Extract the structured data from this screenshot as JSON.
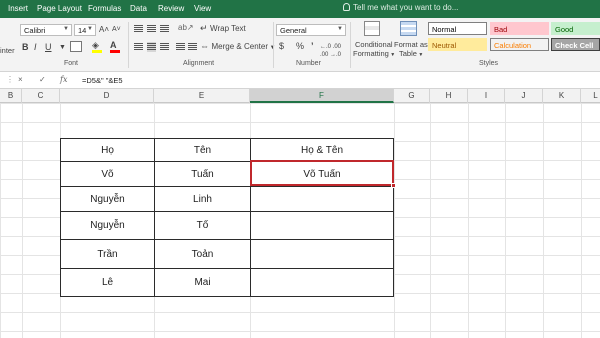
{
  "ribbon_tabs": [
    "Insert",
    "Page Layout",
    "Formulas",
    "Data",
    "Review",
    "View"
  ],
  "tell_me": "Tell me what you want to do...",
  "font": {
    "name": "Calibri",
    "size": "14",
    "increase_icon": "A˄",
    "decrease_icon": "A˅",
    "bold": "B",
    "italic": "I",
    "underline": "U",
    "fill_color": "#ffff00",
    "font_color": "#ff0000",
    "group_label": "Font"
  },
  "paste_partial": "inter",
  "alignment": {
    "wrap_text": "Wrap Text",
    "merge_center": "Merge & Center",
    "group_label": "Alignment"
  },
  "number": {
    "format": "General",
    "currency": "$",
    "percent": "%",
    "comma": "’",
    "inc_decimal": "←.0 .00",
    "dec_decimal": ".00 →.0",
    "group_label": "Number"
  },
  "styles": {
    "conditional_line1": "Conditional",
    "conditional_line2": "Formatting",
    "format_table_line1": "Format as",
    "format_table_line2": "Table",
    "items": [
      {
        "label": "Normal",
        "bg": "#ffffff",
        "color": "#000000",
        "border": "#7f7f7f"
      },
      {
        "label": "Bad",
        "bg": "#ffc7ce",
        "color": "#9c0006",
        "border": "#ffc7ce"
      },
      {
        "label": "Good",
        "bg": "#c6efce",
        "color": "#006100",
        "border": "#c6efce"
      },
      {
        "label": "Neutral",
        "bg": "#ffeb9c",
        "color": "#9c5700",
        "border": "#ffeb9c"
      },
      {
        "label": "Calculation",
        "bg": "#f2f2f2",
        "color": "#fa7d00",
        "border": "#7f7f7f"
      },
      {
        "label": "Check Cell",
        "bg": "#a5a5a5",
        "color": "#ffffff",
        "border": "#3f3f3f"
      }
    ],
    "group_label": "Styles"
  },
  "formula_bar": {
    "cancel": "×",
    "enter": "✓",
    "fx": "fx",
    "formula": "=D5&\" \"&E5"
  },
  "columns": [
    "B",
    "C",
    "D",
    "E",
    "F",
    "G",
    "H",
    "I",
    "J",
    "K",
    "L"
  ],
  "table": {
    "rows": [
      [
        "Họ",
        "Tên",
        "Họ & Tên"
      ],
      [
        "Võ",
        "Tuấn",
        "Võ Tuấn"
      ],
      [
        "Nguyễn",
        "Linh",
        ""
      ],
      [
        "Nguyễn",
        "Tố",
        ""
      ],
      [
        "Trần",
        "Toản",
        ""
      ],
      [
        "Lê",
        "Mai",
        ""
      ]
    ]
  },
  "colors": {
    "accent": "#217346",
    "selection": "#c0282c"
  }
}
